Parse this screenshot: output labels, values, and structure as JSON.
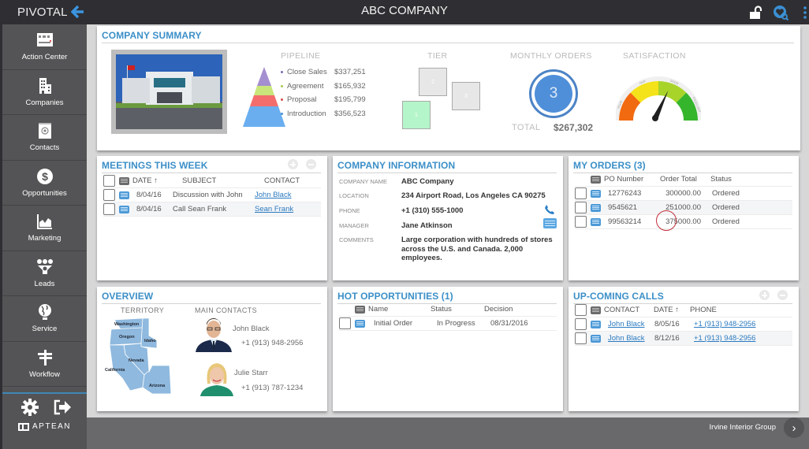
{
  "topbar": {
    "brand": "PIVOTAL",
    "title": "ABC COMPANY",
    "icons": [
      "back-arrow-icon",
      "unlock-icon",
      "search-heart-icon",
      "kebab-menu-icon"
    ]
  },
  "sidebar": {
    "items": [
      {
        "label": "Action Center",
        "icon": "action-center-icon"
      },
      {
        "label": "Companies",
        "icon": "building-icon"
      },
      {
        "label": "Contacts",
        "icon": "contact-book-icon"
      },
      {
        "label": "Opportunities",
        "icon": "dollar-icon"
      },
      {
        "label": "Marketing",
        "icon": "chart-icon"
      },
      {
        "label": "Leads",
        "icon": "leads-icon"
      },
      {
        "label": "Service",
        "icon": "globe-icon"
      },
      {
        "label": "Workflow",
        "icon": "signpost-icon"
      }
    ],
    "bottom_icons": [
      "gear-icon",
      "logout-icon"
    ],
    "vendor_logo": "APTEAN"
  },
  "company_summary": {
    "title": "COMPANY SUMMARY",
    "pipeline": {
      "label": "PIPELINE",
      "stages": [
        {
          "name": "Close Sales",
          "value": "$337,251",
          "color": "#a48fd0"
        },
        {
          "name": "Agreement",
          "value": "$165,932",
          "color": "#c9e67a"
        },
        {
          "name": "Proposal",
          "value": "$195,799",
          "color": "#f36d6d"
        },
        {
          "name": "Introduction",
          "value": "$356,523",
          "color": "#6aaef0"
        }
      ]
    },
    "tier": {
      "label": "TIER",
      "boxes": [
        {
          "num": "1",
          "active": true
        },
        {
          "num": "2",
          "active": false
        },
        {
          "num": "3",
          "active": false
        }
      ]
    },
    "monthly_orders": {
      "label": "MONTHLY ORDERS",
      "count": "3",
      "total_label": "TOTAL",
      "total_value": "$267,302"
    },
    "satisfaction": {
      "label": "SATISFACTION",
      "levels": [
        "POOR",
        "FAIR",
        "GOOD",
        "EXCELLENT"
      ],
      "value_fraction": 0.6
    }
  },
  "meetings": {
    "title": "MEETINGS THIS WEEK",
    "columns": [
      "DATE ↑",
      "SUBJECT",
      "CONTACT"
    ],
    "rows": [
      {
        "date": "8/04/16",
        "subject": "Discussion with John",
        "contact": "John Black"
      },
      {
        "date": "8/04/16",
        "subject": "Call Sean Frank",
        "contact": "Sean Frank"
      }
    ]
  },
  "company_info": {
    "title": "COMPANY INFORMATION",
    "fields": [
      {
        "key": "COMPANY NAME",
        "value": "ABC Company"
      },
      {
        "key": "LOCATION",
        "value": "234 Airport Road, Los Angeles CA 90275"
      },
      {
        "key": "PHONE",
        "value": "+1 (310) 555-1000"
      },
      {
        "key": "MANAGER",
        "value": "Jane Atkinson"
      },
      {
        "key": "COMMENTS",
        "value": "Large corporation with hundreds of stores across the U.S. and Canada. 2,000 employees."
      }
    ]
  },
  "my_orders": {
    "title": "MY ORDERS (3)",
    "columns": [
      "PO Number",
      "Order Total",
      "Status"
    ],
    "rows": [
      {
        "po": "12776243",
        "total": "300000.00",
        "status": "Ordered"
      },
      {
        "po": "9545621",
        "total": "251000.00",
        "status": "Ordered"
      },
      {
        "po": "99563214",
        "total": "375000.00",
        "status": "Ordered"
      }
    ]
  },
  "overview": {
    "title": "OVERVIEW",
    "territory_label": "TERRITORY",
    "states": [
      "Washington",
      "Oregon",
      "Idaho",
      "Nevada",
      "California",
      "Arizona"
    ],
    "contacts_label": "MAIN CONTACTS",
    "contacts": [
      {
        "name": "John Black",
        "phone": "+1 (913) 948-2956"
      },
      {
        "name": "Julie Starr",
        "phone": "+1 (913) 787-1234"
      }
    ]
  },
  "hot_opportunities": {
    "title": "HOT OPPORTUNITIES (1)",
    "columns": [
      "Name",
      "Status",
      "Decision"
    ],
    "rows": [
      {
        "name": "Initial Order",
        "status": "In Progress",
        "decision": "08/31/2016"
      }
    ]
  },
  "upcoming_calls": {
    "title": "UP-COMING CALLS",
    "columns": [
      "CONTACT",
      "DATE ↑",
      "PHONE"
    ],
    "rows": [
      {
        "contact": "John Black",
        "date": "8/05/16",
        "phone": "+1 (913) 948-2956"
      },
      {
        "contact": "John Black",
        "date": "8/12/16",
        "phone": "+1 (913) 948-2956"
      }
    ]
  },
  "footer": {
    "group_name": "Irvine Interior Group"
  }
}
